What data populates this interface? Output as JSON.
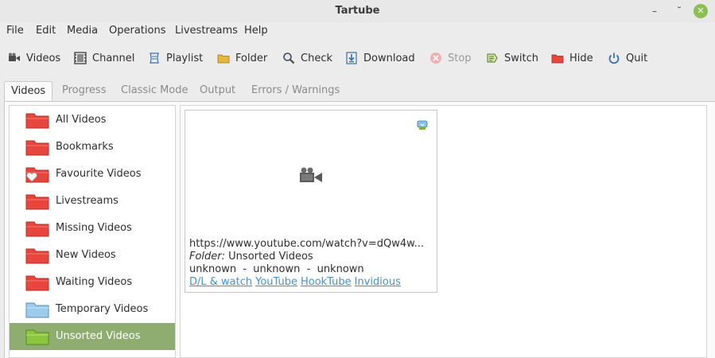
{
  "window": {
    "title": "Tartube"
  },
  "menu": [
    "File",
    "Edit",
    "Media",
    "Operations",
    "Livestreams",
    "Help"
  ],
  "toolbar": {
    "videos": "Videos",
    "channel": "Channel",
    "playlist": "Playlist",
    "folder": "Folder",
    "check": "Check",
    "download": "Download",
    "stop": "Stop",
    "switch": "Switch",
    "hide": "Hide",
    "quit": "Quit"
  },
  "tabs": [
    "Videos",
    "Progress",
    "Classic Mode",
    "Output",
    "Errors / Warnings"
  ],
  "sidebar": {
    "items": [
      {
        "label": "All Videos",
        "color": "#e8453c"
      },
      {
        "label": "Bookmarks",
        "color": "#e8453c"
      },
      {
        "label": "Favourite Videos",
        "color": "#e8453c"
      },
      {
        "label": "Livestreams",
        "color": "#e8453c"
      },
      {
        "label": "Missing Videos",
        "color": "#e8453c"
      },
      {
        "label": "New Videos",
        "color": "#e8453c"
      },
      {
        "label": "Waiting Videos",
        "color": "#e8453c"
      },
      {
        "label": "Temporary Videos",
        "color": "#7fb8e0"
      },
      {
        "label": "Unsorted Videos",
        "color": "#8cc63f"
      }
    ]
  },
  "video_card": {
    "url": "https://www.youtube.com/watch?v=dQw4w...",
    "folder_label": "Folder:",
    "folder_value": "Unsorted Videos",
    "meta": "unknown  -  unknown  -  unknown",
    "links": [
      "D/L & watch",
      "YouTube",
      "HookTube",
      "Invidious"
    ]
  },
  "colors": {
    "selected_row": "#8fad70",
    "link": "#4a90c8"
  }
}
